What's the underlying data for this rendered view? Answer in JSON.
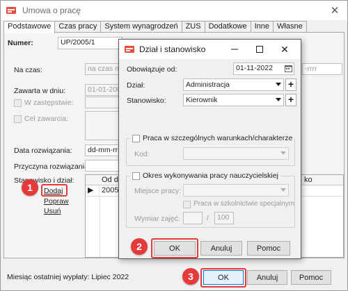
{
  "window": {
    "title": "Umowa o pracę"
  },
  "tabs": [
    {
      "label": "Podstawowe",
      "active": true
    },
    {
      "label": "Czas pracy"
    },
    {
      "label": "System wynagrodzeń"
    },
    {
      "label": "ZUS"
    },
    {
      "label": "Dodatkowe"
    },
    {
      "label": "Inne"
    },
    {
      "label": "Własne"
    }
  ],
  "form": {
    "numer_label": "Numer:",
    "numer_value": "UP/2005/1",
    "na_czas_label": "Na czas:",
    "na_czas_value": "na czas nie",
    "zawarta_label": "Zawarta w dniu:",
    "zawarta_value": "01-01-2005",
    "w_zastepstwie_label": "W zastępstwie:",
    "cel_zawarcia_label": "Cel zawarcia:",
    "data_rozwiazania_label": "Data rozwiązania:",
    "data_rozwiazania_value": "dd-mm-rrrr",
    "przyczyna_label": "Przyczyna rozwiązania:",
    "stanowisko_label": "Stanowisko i dział:",
    "right_date_placeholder": "-rrrr"
  },
  "grid": {
    "headers": [
      "Od d",
      "ko"
    ],
    "row_value": "2005"
  },
  "links": {
    "dodaj": "Dodaj",
    "popraw": "Popraw",
    "usun": "Usuń"
  },
  "statusbar": {
    "last_payment": "Miesiąc ostatniej wypłaty: Lipiec 2022",
    "ok": "OK",
    "anuluj": "Anuluj",
    "pomoc": "Pomoc"
  },
  "dialog": {
    "title": "Dział i stanowisko",
    "obowiazuje_label": "Obowiązuje od:",
    "obowiazuje_value": "01-11-2022",
    "dzial_label": "Dział:",
    "dzial_value": "Administracja",
    "stanowisko_label": "Stanowisko:",
    "stanowisko_value": "Kierownik",
    "praca_szczeg_label": "Praca w szczególnych warunkach/charakterze",
    "kod_label": "Kod:",
    "okres_label": "Okres wykonywania pracy nauczycielskiej",
    "miejsce_label": "Miejsce pracy:",
    "praca_szkolnictwie_label": "Praca w szkolnictwie specjalnym",
    "wymiar_label": "Wymiar zajęć:",
    "wymiar_slash": "/",
    "wymiar_den": "100",
    "ok": "OK",
    "anuluj": "Anuluj",
    "pomoc": "Pomoc"
  },
  "badges": [
    "1",
    "2",
    "3"
  ],
  "colors": {
    "badge": "#e43a3a",
    "accent": "#0078d7"
  }
}
